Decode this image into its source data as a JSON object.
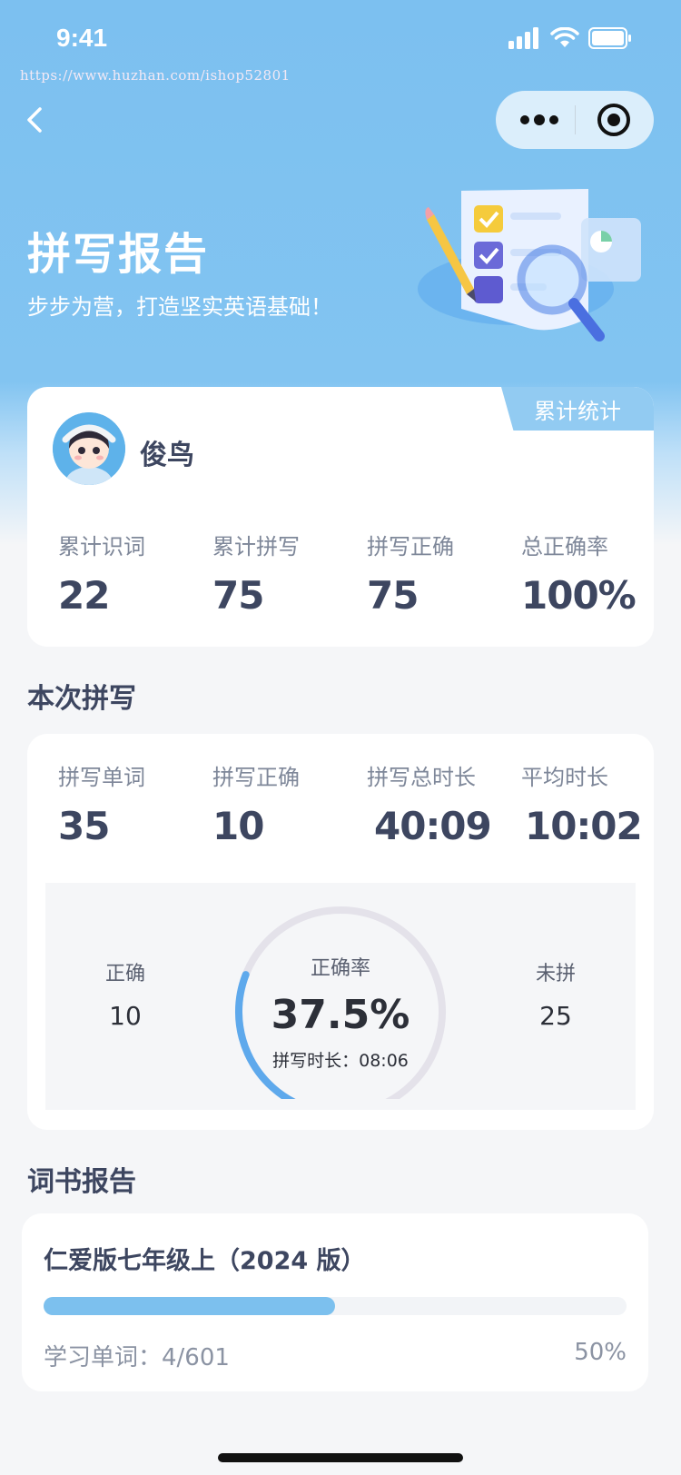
{
  "status_bar": {
    "time": "9:41"
  },
  "watermark": "https://www.huzhan.com/ishop52801",
  "hero": {
    "title": "拼写报告",
    "subtitle": "步步为营，打造坚实英语基础！"
  },
  "summary_card": {
    "tag": "累计统计",
    "username": "俊鸟",
    "stats": [
      {
        "label": "累计识词",
        "value": "22"
      },
      {
        "label": "累计拼写",
        "value": "75"
      },
      {
        "label": "拼写正确",
        "value": "75"
      },
      {
        "label": "总正确率",
        "value": "100%"
      }
    ]
  },
  "session": {
    "section_title": "本次拼写",
    "stats": [
      {
        "label": "拼写单词",
        "value": "35"
      },
      {
        "label": "拼写正确",
        "value": "10"
      },
      {
        "label": "拼写总时长",
        "value": "40:09"
      },
      {
        "label": "平均时长",
        "value": "10:02"
      }
    ],
    "gauge": {
      "correct_label": "正确",
      "correct_value": "10",
      "missed_label": "未拼",
      "missed_value": "25",
      "rate_label": "正确率",
      "rate_value": "37.5%",
      "rate_fraction": 0.2857,
      "time_text": "拼写时长：08:06"
    }
  },
  "book_report": {
    "section_title": "词书报告",
    "book_title": "仁爱版七年级上（2024 版）",
    "learned_text": "学习单词：4/601",
    "percent_text": "50%",
    "progress_fraction": 0.5
  },
  "colors": {
    "accent": "#7cc0ee",
    "tag": "#92cbf2",
    "gauge_arc": "#5ea9ec",
    "gauge_track": "#e4e2ea"
  }
}
